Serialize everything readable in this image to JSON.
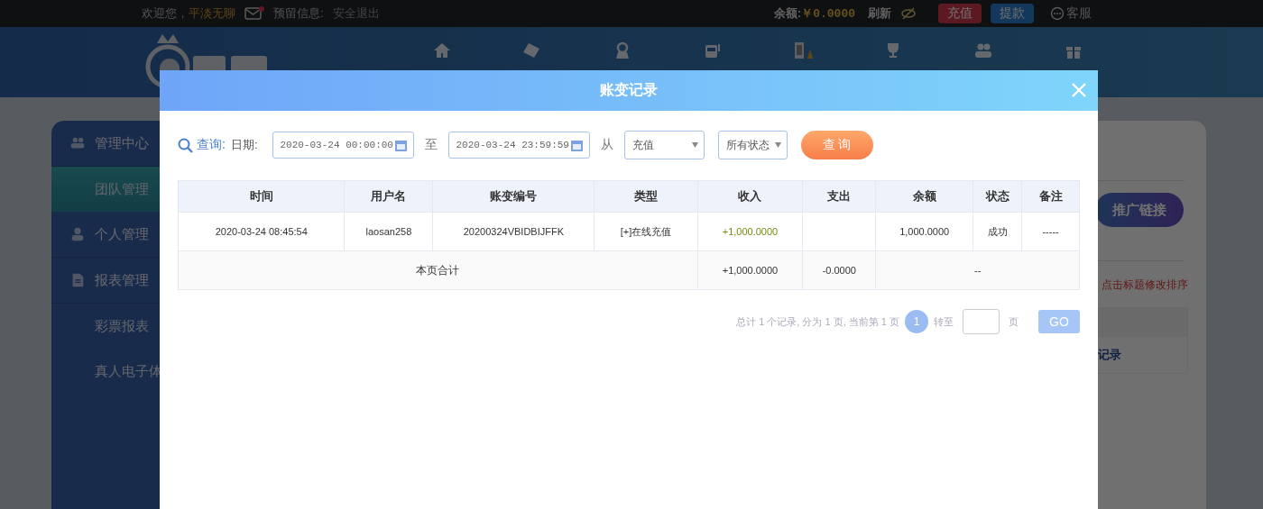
{
  "top_bar": {
    "greeting": "欢迎您，",
    "username": "平淡无聊",
    "has_mail": true,
    "reserved_label": "预留信息:",
    "logout": "安全退出",
    "balance_label": "余额:",
    "balance": "￥0.0000",
    "refresh": "刷新",
    "deposit": "充值",
    "withdraw": "提款",
    "service": "客服"
  },
  "sidebar": [
    {
      "label": "管理中心",
      "children": [
        {
          "label": "团队管理",
          "selected": true
        }
      ]
    },
    {
      "label": "个人管理"
    },
    {
      "label": "报表管理",
      "children": [
        {
          "label": "彩票报表",
          "selected": false
        },
        {
          "label": "真人电子体",
          "selected": false
        }
      ]
    }
  ],
  "panel": {
    "promo_button": "推广链接",
    "hint": "点击标题修改排序",
    "link": "记录"
  },
  "modal": {
    "title": "账变记录",
    "filter": {
      "query_label": "查询:",
      "date_label": "日期:",
      "start": "2020-03-24 00:00:00",
      "to": "至",
      "end": "2020-03-24 23:59:59",
      "from": "从",
      "type": "充值",
      "status": "所有状态",
      "submit": "查 询"
    },
    "table": {
      "columns": [
        "时间",
        "用户名",
        "账变编号",
        "类型",
        "收入",
        "支出",
        "余额",
        "状态",
        "备注"
      ],
      "rows": [
        [
          "2020-03-24 08:45:54",
          "laosan258",
          "20200324VBIDBIJFFK",
          "[+]在线充值",
          "+1,000.0000",
          "",
          "1,000.0000",
          "成功",
          "-----"
        ]
      ],
      "totals": {
        "label": "本页合计",
        "income": "+1,000.0000",
        "expense": "-0.0000",
        "rest": "--"
      }
    },
    "pagination": {
      "summary": "总计 1 个记录, 分为 1 页, 当前第 1 页",
      "pages": [
        {
          "label": "1",
          "selected": true
        }
      ],
      "goto": "转至",
      "unit": "页",
      "go": "GO"
    }
  }
}
